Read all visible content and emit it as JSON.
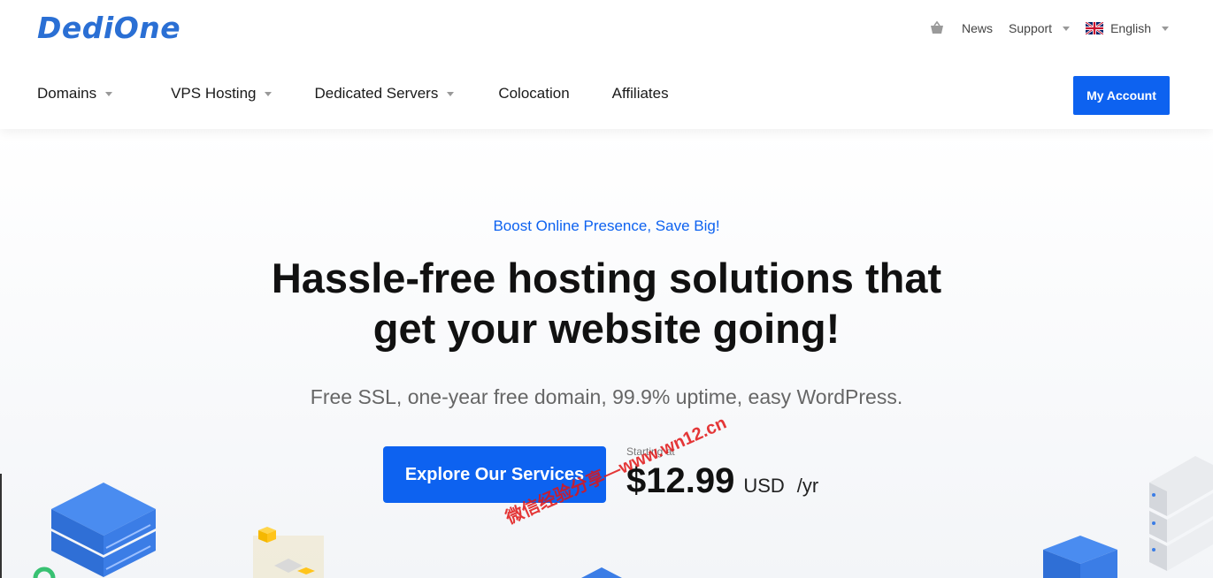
{
  "brand": {
    "logo_text": "DediOne",
    "primary_color": "#0d62f0",
    "logo_color": "#2a6fd4"
  },
  "topbar": {
    "cart_icon": "cart-icon",
    "news_label": "News",
    "support_label": "Support",
    "language_label": "English",
    "language_flag": "uk-flag-icon"
  },
  "nav": {
    "items": [
      {
        "label": "Domains",
        "has_dropdown": true
      },
      {
        "label": "VPS Hosting",
        "has_dropdown": true
      },
      {
        "label": "Dedicated Servers",
        "has_dropdown": true
      },
      {
        "label": "Colocation",
        "has_dropdown": false
      },
      {
        "label": "Affiliates",
        "has_dropdown": false
      }
    ],
    "account_button": "My Account"
  },
  "hero": {
    "eyebrow": "Boost Online Presence, Save Big!",
    "headline_line1": "Hassle-free hosting solutions that",
    "headline_line2": "get your website going!",
    "subline": "Free SSL, one-year free domain, 99.9% uptime, easy WordPress.",
    "cta_label": "Explore Our Services",
    "price_label": "Starting at",
    "price_amount": "$12.99",
    "price_currency": "USD",
    "price_period": "/yr"
  },
  "watermark": {
    "text": "微信经验分享—www.wn12.cn"
  }
}
